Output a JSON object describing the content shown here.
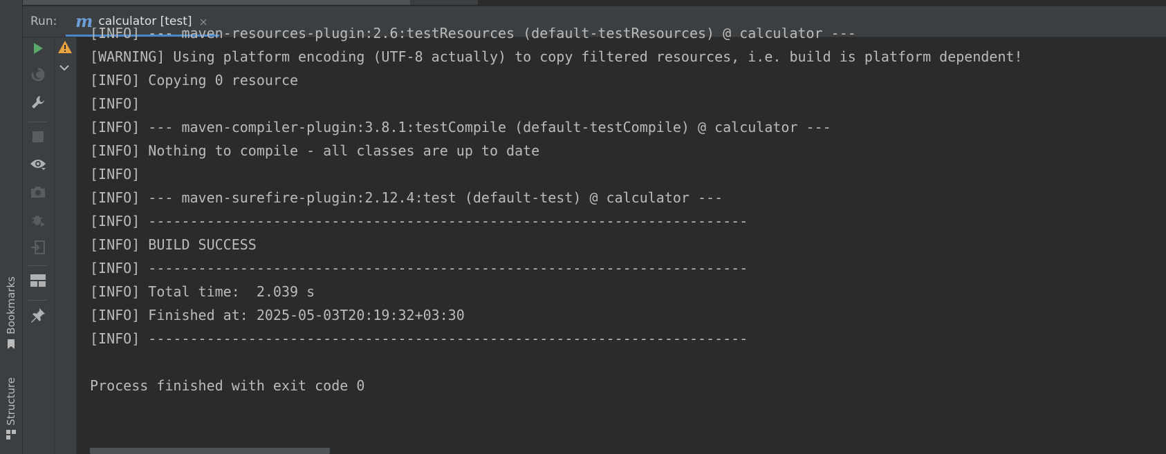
{
  "header": {
    "run_label": "Run:",
    "tab_label": "calculator [test]",
    "tab_icon": "maven-icon",
    "close_glyph": "×"
  },
  "side_tabs": {
    "bookmarks": "Bookmarks",
    "structure": "Structure"
  },
  "console": {
    "lines": [
      "[INFO] --- maven-resources-plugin:2.6:testResources (default-testResources) @ calculator ---",
      "[WARNING] Using platform encoding (UTF-8 actually) to copy filtered resources, i.e. build is platform dependent!",
      "[INFO] Copying 0 resource",
      "[INFO]",
      "[INFO] --- maven-compiler-plugin:3.8.1:testCompile (default-testCompile) @ calculator ---",
      "[INFO] Nothing to compile - all classes are up to date",
      "[INFO]",
      "[INFO] --- maven-surefire-plugin:2.12.4:test (default-test) @ calculator ---",
      "[INFO] ------------------------------------------------------------------------",
      "[INFO] BUILD SUCCESS",
      "[INFO] ------------------------------------------------------------------------",
      "[INFO] Total time:  2.039 s",
      "[INFO] Finished at: 2025-05-03T20:19:32+03:30",
      "[INFO] ------------------------------------------------------------------------",
      "",
      "Process finished with exit code 0"
    ]
  },
  "colors": {
    "run_green": "#59a869",
    "warning_yellow": "#e8a33e",
    "tab_underline": "#4a88c7"
  }
}
